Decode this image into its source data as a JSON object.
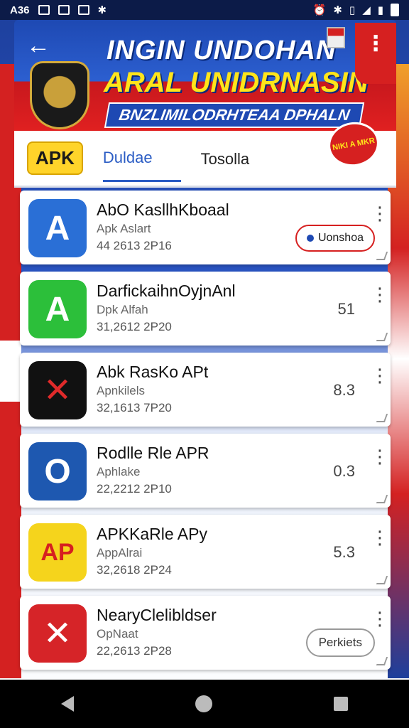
{
  "statusbar": {
    "time": "A36",
    "icons_left": [
      "gallery-icon",
      "image-icon",
      "notification-icon",
      "bluetooth-small-icon"
    ],
    "icons_right": [
      "alarm-icon",
      "bluetooth-icon",
      "vibrate-icon",
      "wifi-icon",
      "signal-icon",
      "battery-icon"
    ]
  },
  "banner": {
    "line1": "INGIN UNDOHAN",
    "line2": "ARAL UNIDRNASIN",
    "ribbon": "BNZLIMILODRHTEAA DPHALN",
    "menu_glyph": "⋮",
    "back_glyph": "←"
  },
  "tabs": {
    "logo": "APK",
    "active": "Duldae",
    "second": "Tosolla",
    "promo": "NIKI A MKR"
  },
  "apps": [
    {
      "name": "AbO KasllhKboaal",
      "sub": "Apk Aslart",
      "date": "44 2613 2P16",
      "rating": "",
      "action": "Uonshoa",
      "icon_glyph": "A",
      "icon_color": "#2a6fd6"
    },
    {
      "name": "DarfickaihnOyjnAnl",
      "sub": "Dpk Alfah",
      "date": "31,2612 2P20",
      "rating": "51",
      "action": "",
      "icon_glyph": "A",
      "icon_color": "#2cbf3a"
    },
    {
      "name": "Abk RasKo APt",
      "sub": "Apnkilels",
      "date": "32,1613 7P20",
      "rating": "8.3",
      "action": "",
      "icon_glyph": "✕",
      "icon_color": "#111111"
    },
    {
      "name": "Rodlle Rle APR",
      "sub": "Aphlake",
      "date": "22,2212 2P10",
      "rating": "0.3",
      "action": "",
      "icon_glyph": "O",
      "icon_color": "#1e58b0"
    },
    {
      "name": "APKKaRle APy",
      "sub": "AppAlrai",
      "date": "32,2618 2P24",
      "rating": "5.3",
      "action": "",
      "icon_glyph": "AP",
      "icon_color": "#f5d41c"
    },
    {
      "name": "NearyClelibldser",
      "sub": "OpNaat",
      "date": "22,2613 2P28",
      "rating": "",
      "action": "Perkiets",
      "icon_glyph": "✕",
      "icon_color": "#d62428"
    }
  ],
  "navbar": {
    "back": "back",
    "home": "home",
    "recents": "recents"
  }
}
